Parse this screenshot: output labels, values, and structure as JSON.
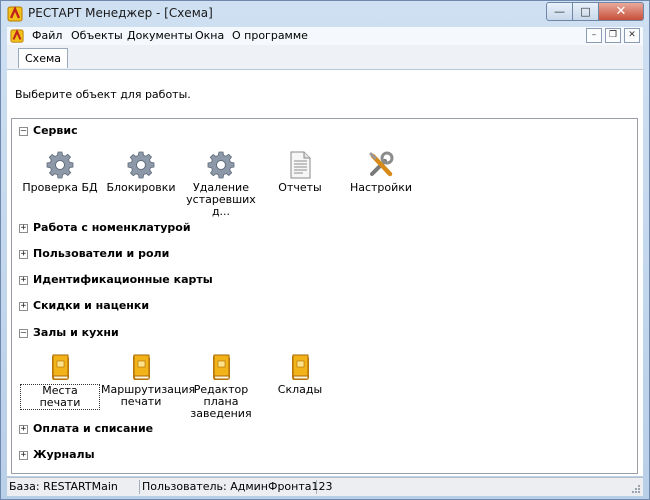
{
  "window": {
    "title": "РЕСТАРТ Менеджер - [Схема]"
  },
  "menu": {
    "items": [
      "Файл",
      "Объекты",
      "Документы",
      "Окна",
      "О программе"
    ]
  },
  "tabs": [
    "Схема"
  ],
  "prompt": "Выберите объект для работы.",
  "sections": [
    {
      "title": "Сервис",
      "expanded": true,
      "items": [
        {
          "label": "Проверка БД",
          "icon": "gear-icon"
        },
        {
          "label": "Блокировки",
          "icon": "gear-icon"
        },
        {
          "label": "Удаление устаревших д...",
          "icon": "gear-icon"
        },
        {
          "label": "Отчеты",
          "icon": "document-icon"
        },
        {
          "label": "Настройки",
          "icon": "tools-icon"
        }
      ]
    },
    {
      "title": "Работа с номенклатурой",
      "expanded": false
    },
    {
      "title": "Пользователи и роли",
      "expanded": false
    },
    {
      "title": "Идентификационные карты",
      "expanded": false
    },
    {
      "title": "Скидки и наценки",
      "expanded": false
    },
    {
      "title": "Залы и кухни",
      "expanded": true,
      "items": [
        {
          "label": "Места печати",
          "icon": "book-icon"
        },
        {
          "label": "Маршрутизация печати",
          "icon": "book-icon"
        },
        {
          "label": "Редактор плана заведения",
          "icon": "book-icon"
        },
        {
          "label": "Склады",
          "icon": "book-icon"
        }
      ]
    },
    {
      "title": "Оплата и списание",
      "expanded": false
    },
    {
      "title": "Журналы",
      "expanded": false
    }
  ],
  "status": {
    "database": "База: RESTARTMain",
    "user": "Пользователь: АдминФронта123"
  },
  "colors": {
    "accent": "#c7d7e9",
    "book": "#e8a317",
    "gear": "#8d99a8"
  }
}
